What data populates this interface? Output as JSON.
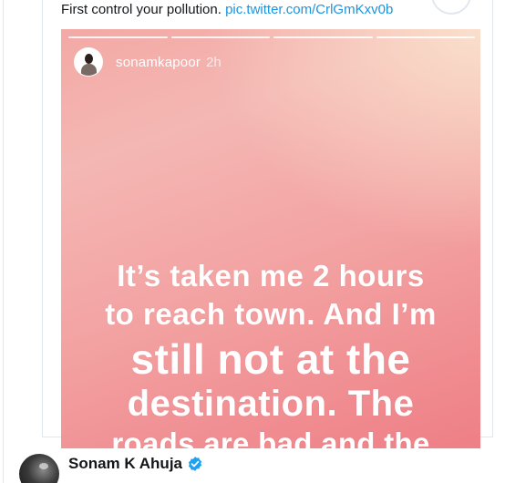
{
  "tweet": {
    "text": "First control your pollution.",
    "link": "pic.twitter.com/CrlGmKxv0b"
  },
  "story": {
    "username": "sonamkapoor",
    "time": "2h",
    "lines": [
      "It’s taken me 2 hours",
      "to reach town. And I’m",
      "still not at the",
      "destination. The",
      "roads are bad and the"
    ]
  },
  "author": {
    "name": "Sonam K Ahuja",
    "verified_icon": "verified-badge-icon"
  },
  "colors": {
    "link": "#1b95e0",
    "verified": "#1da1f2"
  }
}
